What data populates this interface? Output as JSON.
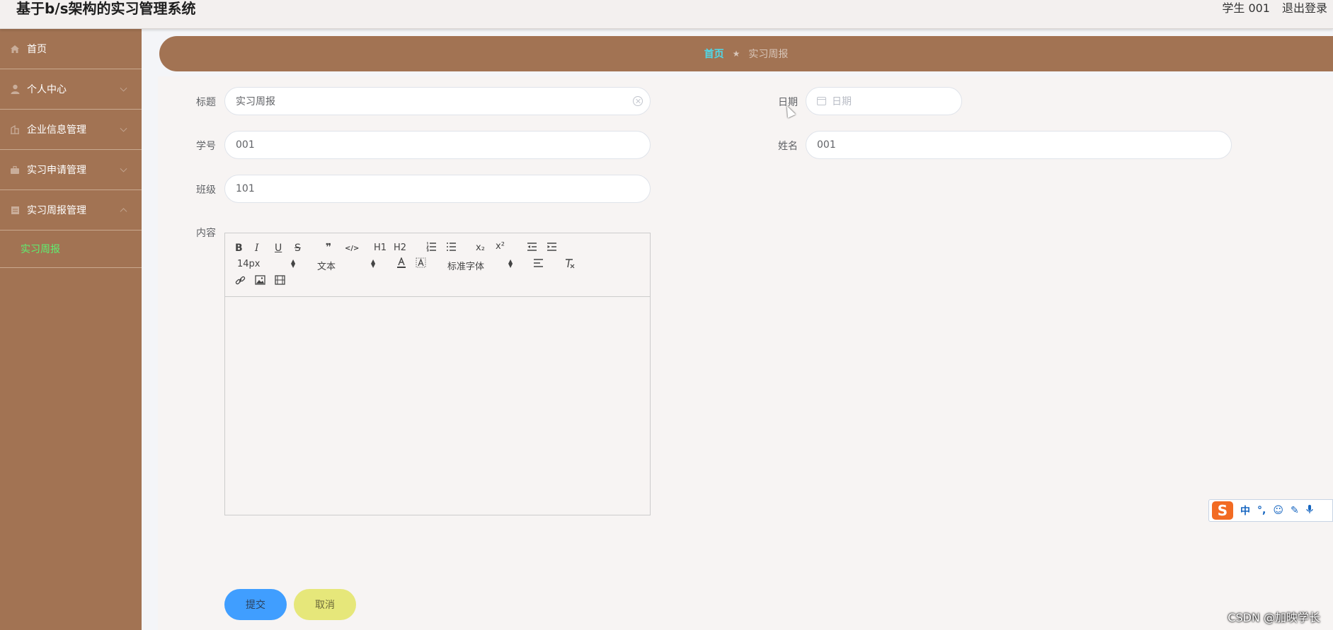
{
  "header": {
    "title": "基于b/s架构的实习管理系统",
    "user": "学生 001",
    "logout": "退出登录"
  },
  "sidebar": {
    "items": [
      {
        "label": "首页",
        "icon": "home-icon"
      },
      {
        "label": "个人中心",
        "icon": "user-icon"
      },
      {
        "label": "企业信息管理",
        "icon": "building-icon"
      },
      {
        "label": "实习申请管理",
        "icon": "briefcase-icon"
      },
      {
        "label": "实习周报管理",
        "icon": "document-icon"
      }
    ],
    "active_sub": "实习周报"
  },
  "breadcrumb": {
    "home": "首页",
    "current": "实习周报"
  },
  "form": {
    "title_label": "标题",
    "title_value": "实习周报",
    "date_label": "日期",
    "date_placeholder": "日期",
    "student_no_label": "学号",
    "student_no_value": "001",
    "name_label": "姓名",
    "name_value": "001",
    "class_label": "班级",
    "class_value": "101",
    "content_label": "内容"
  },
  "editor": {
    "font_size": "14px",
    "paragraph": "文本",
    "font_family": "标准字体",
    "buttons": {
      "bold": "B",
      "italic": "I",
      "underline": "U",
      "strike": "S",
      "quote": "❞",
      "code": "</>",
      "h1": "H1",
      "h2": "H2",
      "sub": "x₂",
      "sup": "x²"
    }
  },
  "buttons": {
    "submit": "提交",
    "cancel": "取消"
  },
  "ime": {
    "lang": "中",
    "punct": "°,",
    "logo": "S"
  },
  "watermark": "CSDN @加映学长",
  "colors": {
    "sidebar": "#a27353",
    "active_sub": "#5ef070",
    "breadcrumb_home": "#4fd9ea",
    "submit": "#409eff",
    "cancel": "#e6e77a"
  }
}
